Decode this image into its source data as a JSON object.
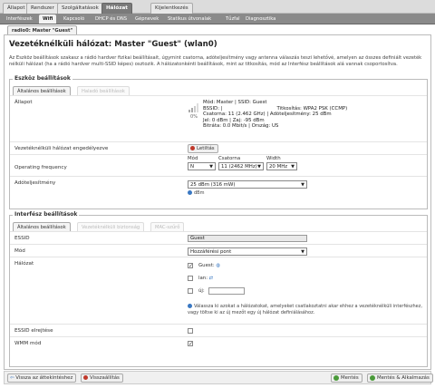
{
  "top_tabs": [
    {
      "name": "tab-allapot",
      "label": "Állapot",
      "active": false
    },
    {
      "name": "tab-rendszer",
      "label": "Rendszer",
      "active": false
    },
    {
      "name": "tab-szolgaltatasok",
      "label": "Szolgáltatások",
      "active": false
    },
    {
      "name": "tab-halozat",
      "label": "Hálózat",
      "active": true
    },
    {
      "name": "tab-kijelentkezes",
      "label": "Kijelentkezés",
      "active": false
    }
  ],
  "sub_tabs": [
    {
      "name": "subtab-interfeszek",
      "label": "Interfészek",
      "active": false
    },
    {
      "name": "subtab-wifi",
      "label": "Wifi",
      "active": true
    },
    {
      "name": "subtab-kapcsolo",
      "label": "Kapcsoló",
      "active": false
    },
    {
      "name": "subtab-dhcp-dns",
      "label": "DHCP és DNS",
      "active": false
    },
    {
      "name": "subtab-gepnevek",
      "label": "Gépnevek",
      "active": false
    },
    {
      "name": "subtab-statikus-utvonalak",
      "label": "Statikus útvonalak",
      "active": false
    },
    {
      "name": "subtab-tuzfal",
      "label": "Tűzfal",
      "active": false
    },
    {
      "name": "subtab-diagnosztika",
      "label": "Diagnosztika",
      "active": false
    }
  ],
  "interface_tab": "radio0: Master \"Guest\"",
  "page_title": "Vezetéknélküli hálózat: Master \"Guest\" (wlan0)",
  "description": "Az Eszköz beállítások szakasz a rádió hardver fizikai beállításait, úgymint csatorna, adóteljesítmény vagy antenna válaszás teszi lehetővé, amelyen az összes definiált vezeték nélküli hálózat (ha a rádió hardver multi-SSID képes) osztozik. A hálózatonkénti beállítások, mint az titkosítás, mód az Interfész beállítások alá vannak csoportosítva.",
  "device_section": {
    "legend": "Eszköz beállítások",
    "tab_general": "Általános beállítások",
    "tab_advanced": "Haladó beállítások",
    "status_label": "Állapot",
    "status": {
      "line1": "Mód: Master | SSID: Guest",
      "line2a": "BSSID: |",
      "line2b": "Titkosítás: WPA2 PSK (CCMP)",
      "line3": "Csatorna: 11 (2.462 GHz) | Adóteljesítmény: 25 dBm",
      "line4": "Jel: 0 dBm | Zaj: -95 dBm",
      "line5": "Bitráta: 0.0 Mbit/s | Ország: US",
      "signal_pct": "0%"
    },
    "enable_label": "Vezetéknélküli hálózat engedélyezve",
    "disable_button": "Letiltás",
    "freq_label": "Operating frequency",
    "mode_col": "Mód",
    "channel_col": "Csatorna",
    "width_col": "Width",
    "mode_value": "N",
    "channel_value": "11 (2462 MHz)",
    "width_value": "20 MHz",
    "txpower_label": "Adóteljesítmény",
    "txpower_value": "25 dBm (316 mW)",
    "txpower_unit": "dBm"
  },
  "iface_section": {
    "legend": "Interfész beállítások",
    "tab_general": "Általános beállítások",
    "tab_security": "Vezetéknélküli biztonság",
    "tab_mac": "MAC-szűrő",
    "essid_label": "ESSID",
    "essid_value": "Guest",
    "mode_label": "Mód",
    "mode_value": "Hozzáférési pont",
    "network_label": "Hálózat",
    "net_guest": "Guest:",
    "net_lan": "lan:",
    "net_new": "új:",
    "network_help": "Válassza ki azokat a hálózatokat, amelyeket csatlakoztatni akar ehhez a vezetéknélküli interfészhez, vagy töltse ki az új mezőt egy új hálózat definiálásához.",
    "hide_label": "ESSID elrejtése",
    "wmm_label": "WMM mód"
  },
  "footer": {
    "back": "Vissza az áttekintéshez",
    "reset": "Visszaállítás",
    "save": "Mentés",
    "save_apply": "Mentés & Alkalmazás"
  },
  "colors": {
    "accent": "#7a7a7a",
    "danger": "#c0392b",
    "success": "#4a9a3a"
  }
}
